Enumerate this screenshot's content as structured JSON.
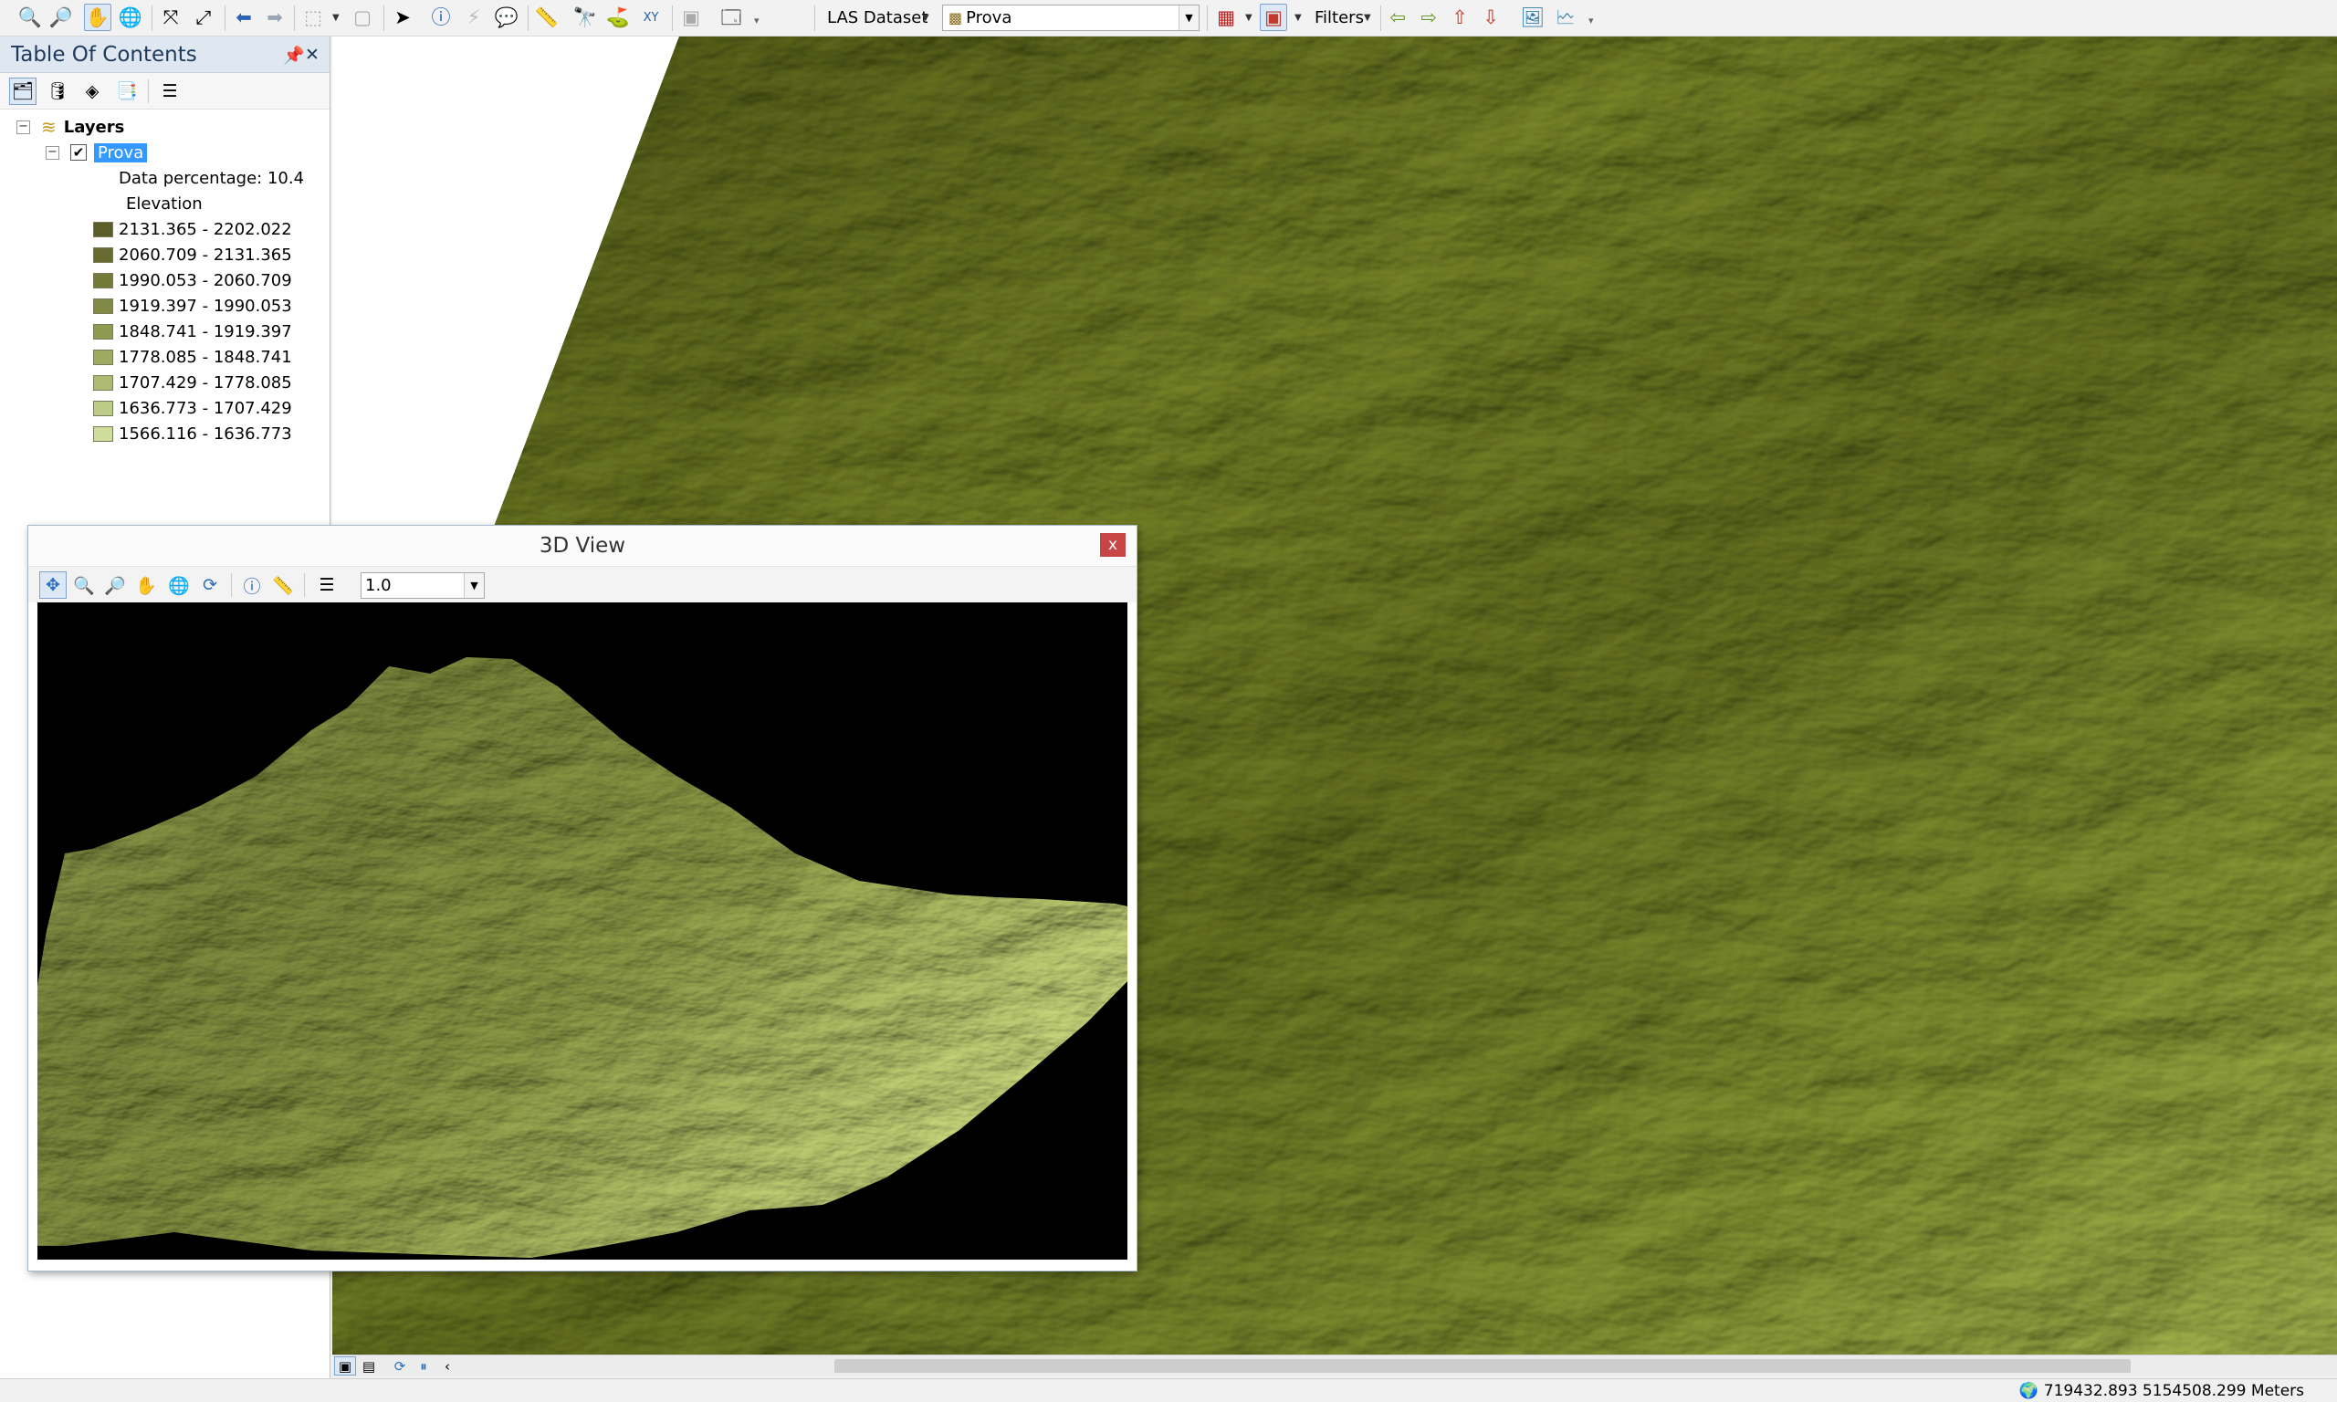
{
  "toolbar": {
    "las_dataset_label": "LAS Dataset",
    "layer_combo_value": "Prova",
    "filters_label": "Filters"
  },
  "toc": {
    "title": "Table Of Contents",
    "root_label": "Layers",
    "layer": {
      "name": "Prova",
      "checked": true,
      "data_percentage": "Data percentage: 10.4",
      "legend_heading": "Elevation",
      "classes": [
        {
          "label": "2131.365 - 2202.022",
          "color": "#5b5e2a"
        },
        {
          "label": "2060.709 - 2131.365",
          "color": "#676b30"
        },
        {
          "label": "1990.053 - 2060.709",
          "color": "#737a38"
        },
        {
          "label": "1919.397 - 1990.053",
          "color": "#818a44"
        },
        {
          "label": "1848.741 - 1919.397",
          "color": "#8e9a50"
        },
        {
          "label": "1778.085 - 1848.741",
          "color": "#9daa60"
        },
        {
          "label": "1707.429 - 1778.085",
          "color": "#acba72"
        },
        {
          "label": "1636.773 - 1707.429",
          "color": "#bccb86"
        },
        {
          "label": "1566.116 - 1636.773",
          "color": "#cedc9c"
        }
      ]
    }
  },
  "view3d": {
    "title": "3D View",
    "close_label": "x",
    "exaggeration_value": "1.0"
  },
  "status": {
    "coordinates": "719432.893  5154508.299 Meters"
  }
}
